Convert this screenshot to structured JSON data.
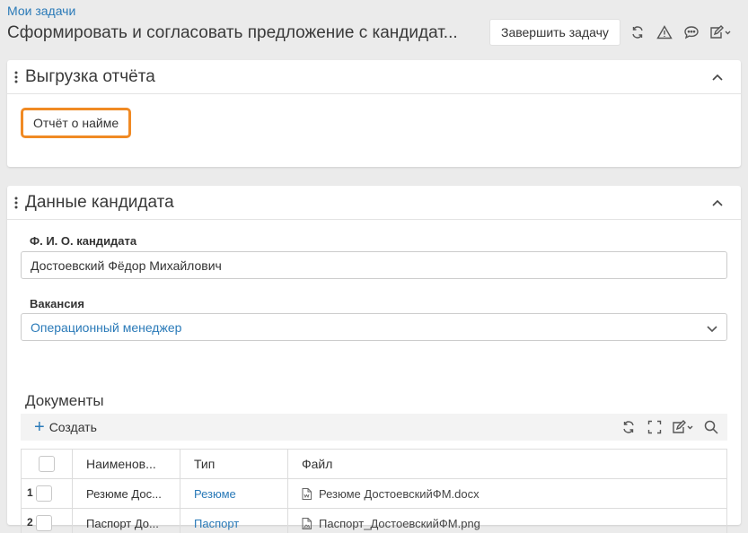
{
  "header": {
    "breadcrumb": "Мои задачи",
    "title": "Сформировать и согласовать предложение с кандидат...",
    "complete_button": "Завершить задачу"
  },
  "toolbar_icons": [
    "refresh-icon",
    "warning-icon",
    "comment-icon",
    "edit-icon"
  ],
  "report_panel": {
    "title": "Выгрузка отчёта",
    "report_button": "Отчёт о найме"
  },
  "candidate_panel": {
    "title": "Данные кандидата",
    "fio_label": "Ф. И. О. кандидата",
    "fio_value": "Достоевский Фёдор Михайлович",
    "vacancy_label": "Вакансия",
    "vacancy_value": "Операционный менеджер",
    "documents_title": "Документы",
    "create_button": "Создать",
    "columns": [
      "Наименов...",
      "Тип",
      "Файл"
    ],
    "rows": [
      {
        "num": "1",
        "name": "Резюме Дос...",
        "type": "Резюме",
        "file": "Резюме ДостоевскийФМ.docx"
      },
      {
        "num": "2",
        "name": "Паспорт До...",
        "type": "Паспорт",
        "file": "Паспорт_ДостоевскийФМ.png"
      }
    ]
  },
  "colors": {
    "accent": "#2a7ab8",
    "highlight": "#f08a24",
    "background": "#ebebeb"
  }
}
